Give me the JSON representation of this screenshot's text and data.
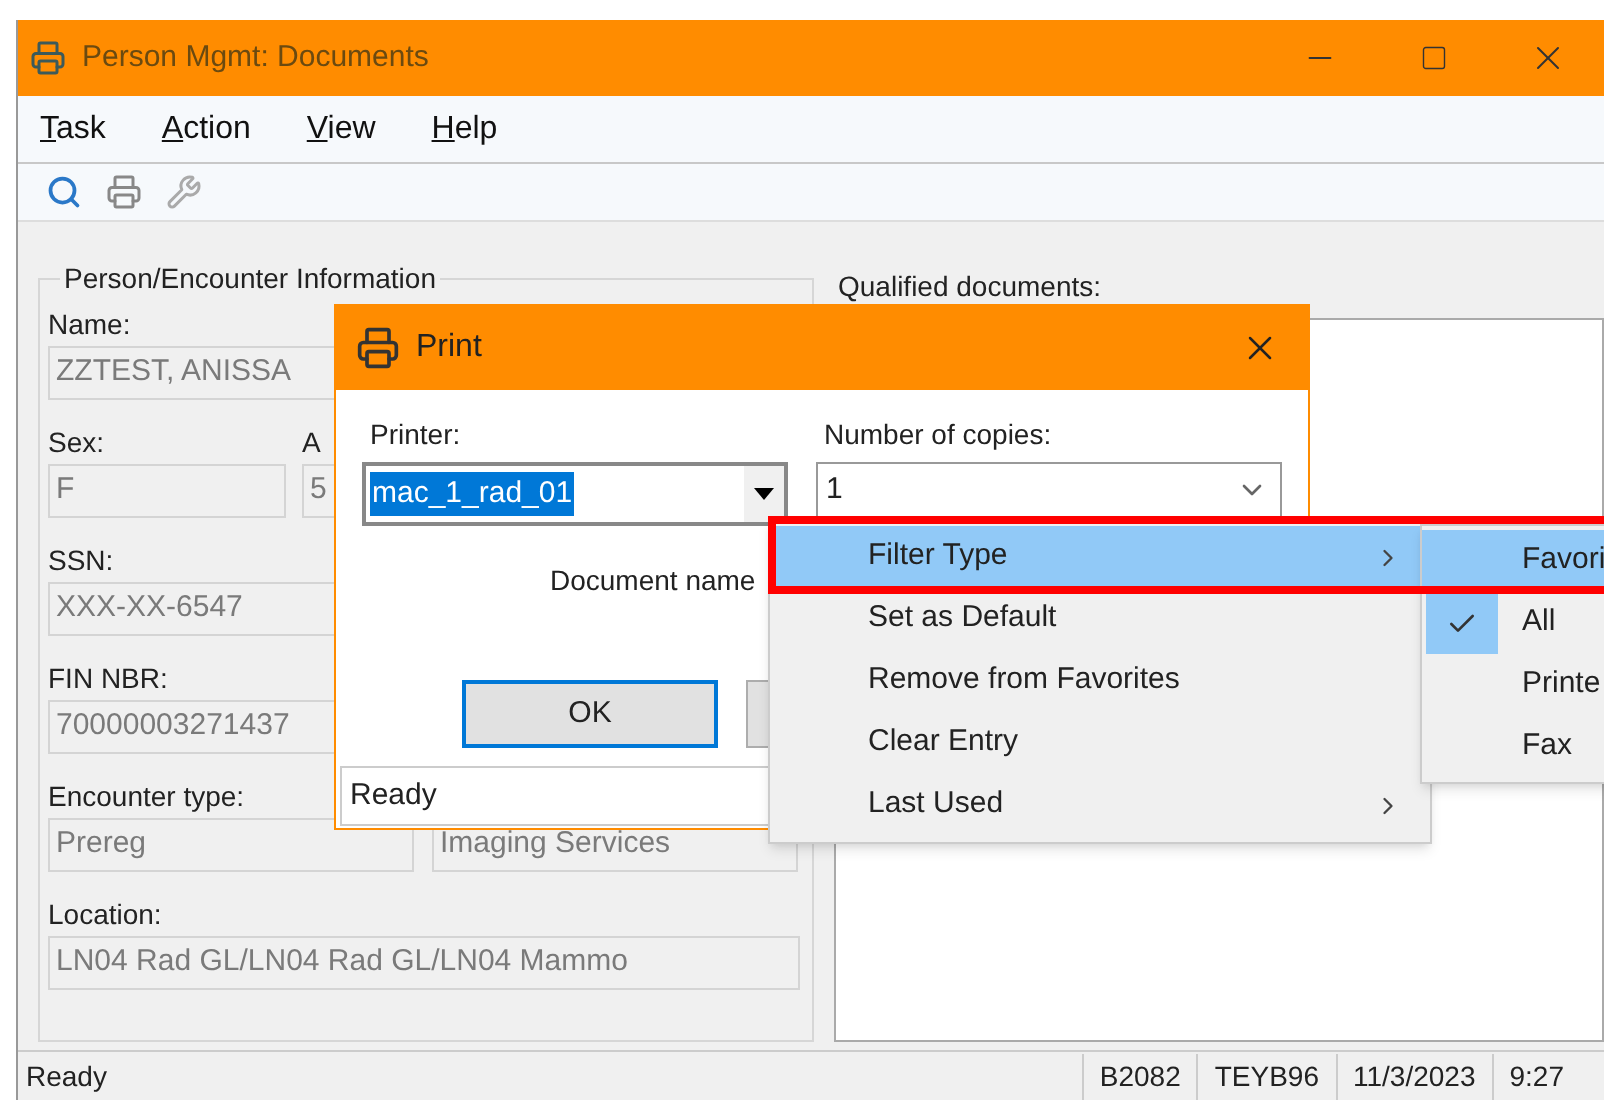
{
  "window": {
    "title": "Person Mgmt: Documents"
  },
  "menu": [
    {
      "mnemonic": "T",
      "rest": "ask"
    },
    {
      "mnemonic": "A",
      "rest": "ction"
    },
    {
      "mnemonic": "V",
      "rest": "iew"
    },
    {
      "mnemonic": "H",
      "rest": "elp"
    }
  ],
  "person_panel": {
    "title": "Person/Encounter Information",
    "name": {
      "label": "Name:",
      "value": "ZZTEST, ANISSA"
    },
    "sex": {
      "label": "Sex:",
      "value": "F"
    },
    "age": {
      "label": "A",
      "value": "5"
    },
    "ssn": {
      "label": "SSN:",
      "value": "XXX-XX-6547"
    },
    "fin": {
      "label": "FIN NBR:",
      "value": "70000003271437"
    },
    "encounter": {
      "label": "Encounter type:",
      "values": [
        "Prereg",
        "Imaging Services"
      ]
    },
    "location": {
      "label": "Location:",
      "value": "LN04 Rad GL/LN04 Rad GL/LN04 Mammo"
    }
  },
  "documents": {
    "label": "Qualified documents:"
  },
  "print_dialog": {
    "title": "Print",
    "printer_label": "Printer:",
    "printer_value": "mac_1_rad_01",
    "printer_value_selected": true,
    "copies_label": "Number of copies:",
    "copies_value": "1",
    "document_name_label": "Document name",
    "ok_button": "OK",
    "status": "Ready"
  },
  "context_menu": {
    "items": [
      {
        "label": "Filter Type",
        "selected": true,
        "submenu": true
      },
      {
        "label": "Set as Default",
        "selected": false,
        "submenu": false
      },
      {
        "label": "Remove from Favorites",
        "selected": false,
        "submenu": false
      },
      {
        "label": "Clear Entry",
        "selected": false,
        "submenu": false
      },
      {
        "label": "Last Used",
        "selected": false,
        "submenu": true
      }
    ]
  },
  "submenu": {
    "items": [
      {
        "label": "Favori",
        "selected": true,
        "checked": false
      },
      {
        "label": "All",
        "selected": false,
        "checked": true
      },
      {
        "label": "Printe",
        "selected": false,
        "checked": false
      },
      {
        "label": "Fax",
        "selected": false,
        "checked": false
      }
    ]
  },
  "status_bar": [
    "Ready",
    "B2082",
    "TEYB96",
    "11/3/2023",
    "9:27"
  ]
}
